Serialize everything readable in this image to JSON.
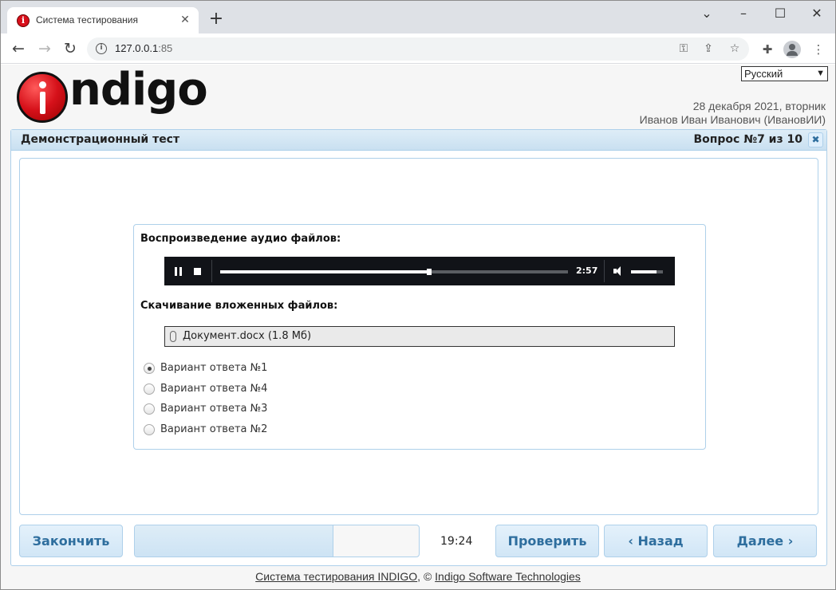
{
  "browser": {
    "tab_title": "Система тестирования",
    "url_host": "127.0.0.1",
    "url_port": ":85"
  },
  "header": {
    "logo_letter": "i",
    "logo_text": "ndigo",
    "language": "Русский",
    "date": "28 декабря 2021, вторник",
    "user": "Иванов Иван Иванович (ИвановИИ)"
  },
  "panel": {
    "title": "Демонстрационный тест",
    "question_number": "Вопрос №7 из 10"
  },
  "question": {
    "audio_label": "Воспроизведение аудио файлов:",
    "audio_time": "2:57",
    "audio_progress": 0.6,
    "volume_level": 0.8,
    "files_label": "Скачивание вложенных файлов:",
    "file_link": "Документ.docx (1.8 Мб)",
    "answers": [
      {
        "label": "Вариант ответа №1",
        "checked": true
      },
      {
        "label": "Вариант ответа №4",
        "checked": false
      },
      {
        "label": "Вариант ответа №3",
        "checked": false
      },
      {
        "label": "Вариант ответа №2",
        "checked": false
      }
    ]
  },
  "controls": {
    "finish": "Закончить",
    "progress": 0.7,
    "timer": "19:24",
    "check": "Проверить",
    "back": "‹ Назад",
    "next": "Далее ›"
  },
  "footer": {
    "system_link": "Система тестирования INDIGO",
    "separator": ", © ",
    "company_link": "Indigo Software Technologies"
  },
  "colors": {
    "accent": "#2e6e9e",
    "border": "#aed0ea",
    "brand_red": "#d6111a"
  }
}
